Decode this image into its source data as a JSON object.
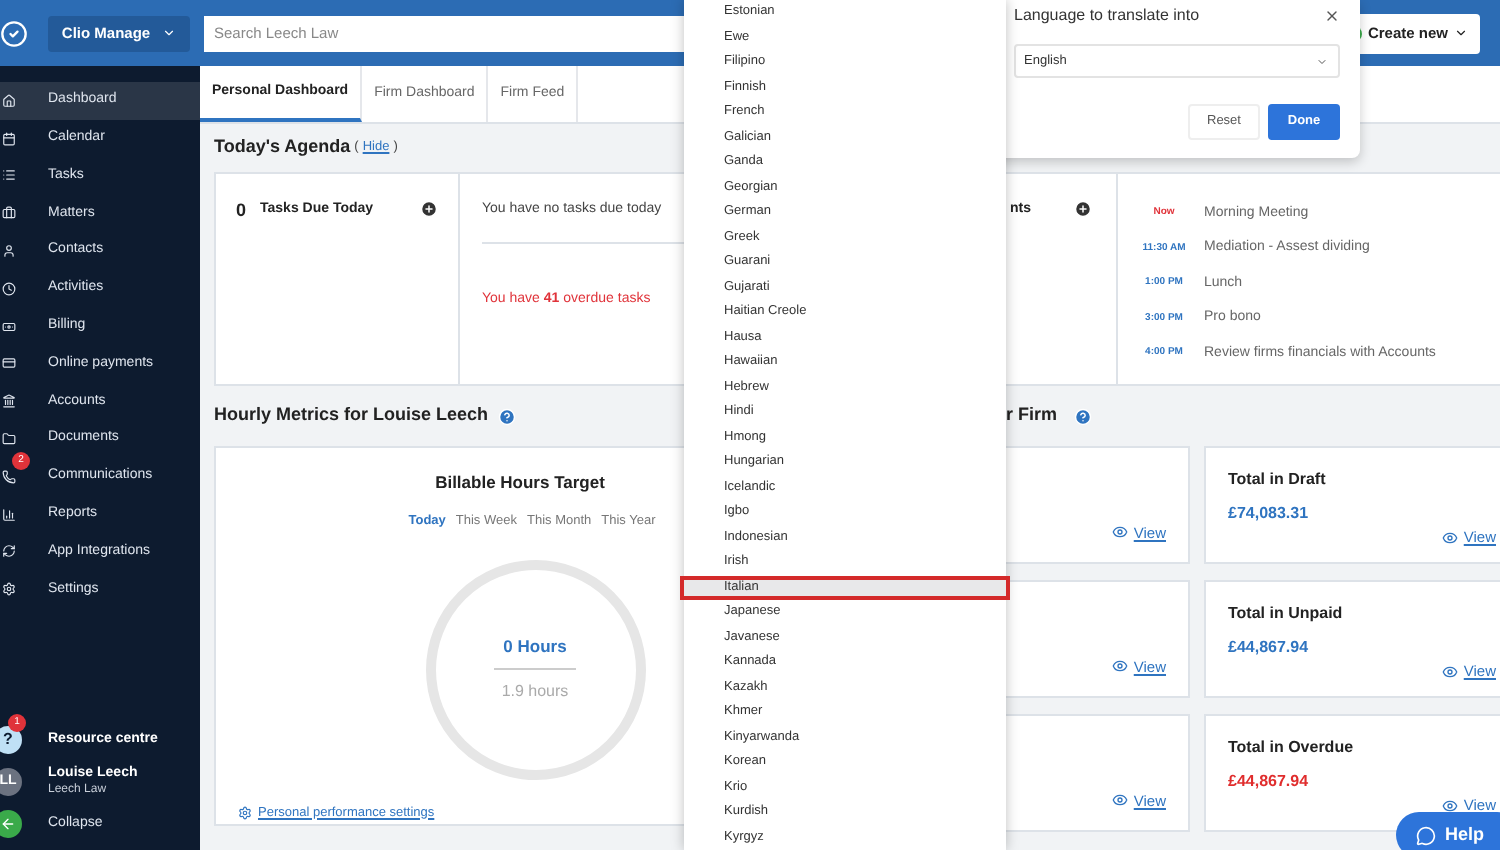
{
  "top_bar": {
    "app_switcher": "Clio Manage",
    "search": {
      "placeholder": "Search Leech Law"
    },
    "create_button": "Create new"
  },
  "sidebar": {
    "items": [
      {
        "label": "Dashboard",
        "selected": true
      },
      {
        "label": "Calendar",
        "selected": false
      },
      {
        "label": "Tasks",
        "selected": false
      },
      {
        "label": "Matters",
        "selected": false
      },
      {
        "label": "Contacts",
        "selected": false
      },
      {
        "label": "Activities",
        "selected": false
      },
      {
        "label": "Billing",
        "selected": false
      },
      {
        "label": "Online payments",
        "selected": false
      },
      {
        "label": "Accounts",
        "selected": false
      },
      {
        "label": "Documents",
        "selected": false
      },
      {
        "label": "Communications",
        "selected": false,
        "badge": "2"
      },
      {
        "label": "Reports",
        "selected": false
      },
      {
        "label": "App Integrations",
        "selected": false
      },
      {
        "label": "Settings",
        "selected": false
      }
    ],
    "resource_centre": {
      "label": "Resource centre",
      "badge": "1",
      "icon_text": "?"
    },
    "user": {
      "initials": "LL",
      "name": "Louise Leech",
      "firm": "Leech Law"
    },
    "collapse": "Collapse"
  },
  "tabs": [
    {
      "label": "Personal Dashboard",
      "selected": true
    },
    {
      "label": "Firm Dashboard",
      "selected": false
    },
    {
      "label": "Firm Feed",
      "selected": false
    }
  ],
  "agenda": {
    "title": "Today's Agenda",
    "hide_prefix": "(",
    "hide_link": "Hide",
    "hide_suffix": ")",
    "tasks": {
      "count": "0",
      "label": "Tasks Due Today",
      "none_message": "You have no tasks due today",
      "overdue_message": "You have **41** overdue tasks"
    },
    "appointments": {
      "label": "nts",
      "schedule": [
        {
          "time": "Now",
          "current": true,
          "event": "Morning Meeting"
        },
        {
          "time": "11:30 AM",
          "current": false,
          "event": "Mediation - Assest dividing"
        },
        {
          "time": "1:00 PM",
          "current": false,
          "event": "Lunch"
        },
        {
          "time": "3:00 PM",
          "current": false,
          "event": "Pro bono"
        },
        {
          "time": "4:00 PM",
          "current": false,
          "event": "Review firms financials with Accounts"
        }
      ]
    }
  },
  "hourly_metrics": {
    "title": "Hourly Metrics for Louise Leech",
    "card": {
      "title": "Billable Hours Target",
      "periods": [
        {
          "label": "Today",
          "selected": true
        },
        {
          "label": "This Week",
          "selected": false
        },
        {
          "label": "This Month",
          "selected": false
        },
        {
          "label": "This Year",
          "selected": false
        }
      ],
      "hours": "0 Hours",
      "target": "1.9 hours",
      "settings_link": "Personal performance settings"
    }
  },
  "firm_metrics": {
    "title": "r Firm",
    "rows": [
      {
        "left": {
          "view_link": "View"
        },
        "right": {
          "title": "Total in Draft",
          "amount": "£74,083.31",
          "color": "#2f74c0",
          "view_link": "View"
        }
      },
      {
        "left": {
          "view_link": "View"
        },
        "right": {
          "title": "Total in Unpaid",
          "amount": "£44,867.94",
          "color": "#2f74c0",
          "view_link": "View"
        }
      },
      {
        "left": {
          "view_link": "View"
        },
        "right": {
          "title": "Total in Overdue",
          "amount": "£44,867.94",
          "color": "#e02d2d",
          "view_link": "View"
        }
      }
    ]
  },
  "language_dropdown": {
    "options": [
      {
        "label": "Estonian",
        "selected": false
      },
      {
        "label": "Ewe",
        "selected": false
      },
      {
        "label": "Filipino",
        "selected": false
      },
      {
        "label": "Finnish",
        "selected": false
      },
      {
        "label": "French",
        "selected": false
      },
      {
        "label": "Galician",
        "selected": false
      },
      {
        "label": "Ganda",
        "selected": false
      },
      {
        "label": "Georgian",
        "selected": false
      },
      {
        "label": "German",
        "selected": false
      },
      {
        "label": "Greek",
        "selected": false
      },
      {
        "label": "Guarani",
        "selected": false
      },
      {
        "label": "Gujarati",
        "selected": false
      },
      {
        "label": "Haitian Creole",
        "selected": false
      },
      {
        "label": "Hausa",
        "selected": false
      },
      {
        "label": "Hawaiian",
        "selected": false
      },
      {
        "label": "Hebrew",
        "selected": false
      },
      {
        "label": "Hindi",
        "selected": false
      },
      {
        "label": "Hmong",
        "selected": false
      },
      {
        "label": "Hungarian",
        "selected": false
      },
      {
        "label": "Icelandic",
        "selected": false
      },
      {
        "label": "Igbo",
        "selected": false
      },
      {
        "label": "Indonesian",
        "selected": false
      },
      {
        "label": "Irish",
        "selected": false
      },
      {
        "label": "Italian",
        "selected": true
      },
      {
        "label": "Japanese",
        "selected": false
      },
      {
        "label": "Javanese",
        "selected": false
      },
      {
        "label": "Kannada",
        "selected": false
      },
      {
        "label": "Kazakh",
        "selected": false
      },
      {
        "label": "Khmer",
        "selected": false
      },
      {
        "label": "Kinyarwanda",
        "selected": false
      },
      {
        "label": "Korean",
        "selected": false
      },
      {
        "label": "Krio",
        "selected": false
      },
      {
        "label": "Kurdish",
        "selected": false
      },
      {
        "label": "Kyrgyz",
        "selected": false
      }
    ]
  },
  "translate_dialog": {
    "title": "Language to translate into",
    "language": "English",
    "buttons": [
      {
        "label": "Reset",
        "kind": "secondary"
      },
      {
        "label": "Done",
        "kind": "primary"
      }
    ]
  },
  "help_button": "Help"
}
